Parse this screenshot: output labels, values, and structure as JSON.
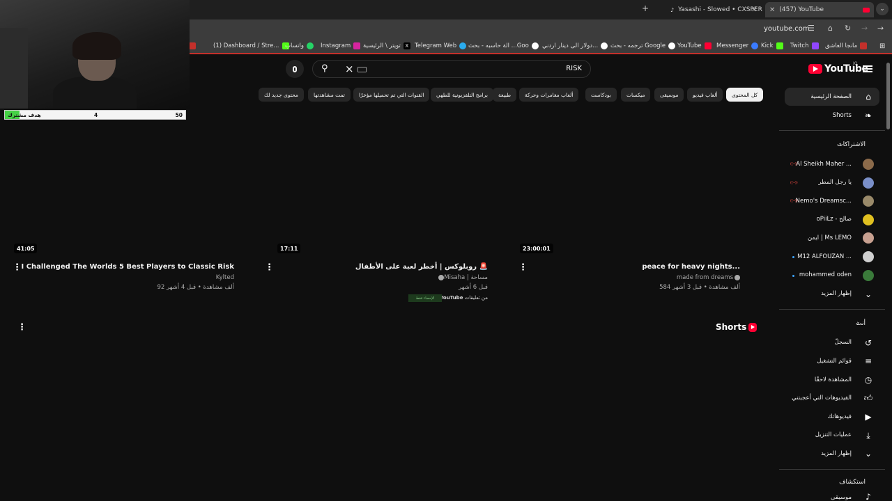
{
  "browser": {
    "tabs": [
      {
        "title": "Yasashi - Slowed • CXSPER"
      },
      {
        "title": "(457) YouTube"
      }
    ],
    "new_tab": "+",
    "close": "✕",
    "tab_menu": "⌄",
    "url": "youtube.com",
    "bookmarks": [
      "الة حاسبه - بحث ...Goo",
      "Telegram Web",
      "تويتر \\ الرئيسية",
      "Instagram",
      "واتساب",
      "(1) Dashboard / Stre...",
      "ال",
      "دولار الى دينار اردني...",
      "ترجمه - بحث Google",
      "YouTube",
      "Messenger",
      "Kick",
      "Twitch",
      "مانجا العاشق"
    ]
  },
  "masthead": {
    "logo_text": "YouTube",
    "logo_sup": "JO",
    "search_value": "RISK"
  },
  "chips": [
    "كل المحتوى",
    "ألعاب فيديو",
    "موسيقى",
    "ميكسات",
    "بودكاست",
    "ألعاب مغامرات وحركة",
    "طبيعة",
    "برامج التلفزيونية للطهي",
    "القنوات التي تم تحميلها مؤخرًا",
    "تمت مشاهدتها",
    "محتوى جديد لك"
  ],
  "sidebar": {
    "home": "الصفحة الرئيسية",
    "shorts": "Shorts",
    "subscriptions_header": "الاشتراكات",
    "subscriptions": [
      {
        "name": "Al Sheikh Maher ...",
        "live": true,
        "color": "#8b6a4a"
      },
      {
        "name": "يا رجل المطر",
        "live": true,
        "color": "#7a8fc8"
      },
      {
        "name": "Nemo's Dreamsc...",
        "live": true,
        "color": "#9a8a6a"
      },
      {
        "name": "oPiiLz - صالح",
        "live": false,
        "color": "#e0c020"
      },
      {
        "name": "ايمن | Ms LEMO",
        "live": false,
        "color": "#c8a090"
      },
      {
        "name": "M12 ALFOUZAN ...",
        "live": false,
        "dot": true,
        "color": "#cfcfcf"
      },
      {
        "name": "mohammed oden",
        "live": false,
        "dot": true,
        "color": "#3a7a3a"
      }
    ],
    "show_more": "إظهار المزيد",
    "you_header": "أنت",
    "you_items": [
      "السجلّ",
      "قوائم التشغيل",
      "المشاهدة لاحقًا",
      "الفيديوهات التي أعجبتني",
      "فيديوهاتك",
      "عمليات التنزيل",
      "إظهار المزيد"
    ],
    "explore_header": "استكشاف",
    "explore_first": "موسيقى"
  },
  "videos": [
    {
      "duration": "23:00:01",
      "title": "peace for heavy nights...",
      "channel": "made from dreams",
      "meta": "584 ألف مشاهدة • قبل 3 أشهر"
    },
    {
      "duration": "17:11",
      "title": "روبلوكس | أخطر لعبة على الأطفال 🚨",
      "channel": "Misaha | مساحة",
      "meta": "قبل 6 أشهر",
      "source_prefix": "من تعليقات",
      "source_brand": "YouTube",
      "badge": "الإحصاء فقط"
    },
    {
      "duration": "41:05",
      "title": "I Challenged The Worlds 5 Best Players to Classic Risk",
      "channel": "Kylted",
      "meta": "92 ألف مشاهدة • قبل 4 أشهر"
    }
  ],
  "shorts_section": {
    "title": "Shorts"
  },
  "overlay": {
    "goal_label": "هدف مشترك",
    "goal_current": "4",
    "goal_target": "50",
    "goal_progress": 0.08
  },
  "colors": {
    "accent_red": "#ff0033",
    "background": "#0f0f0f",
    "goal_green": "#45d145"
  }
}
